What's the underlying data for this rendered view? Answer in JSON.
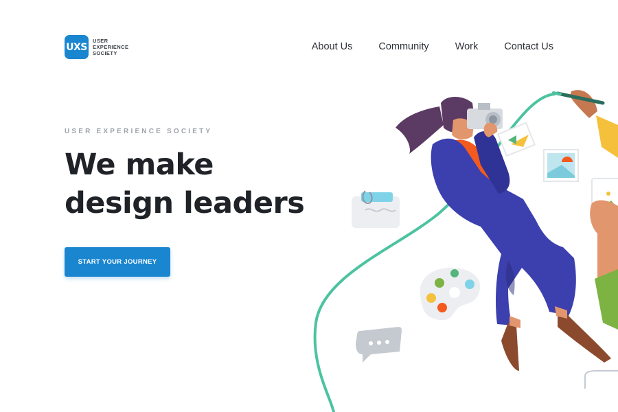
{
  "brand": {
    "logo_mark": "UXS",
    "name_lines": [
      "USER",
      "EXPERIENCE",
      "SOCIETY"
    ],
    "color": "#1a86d0"
  },
  "nav": {
    "items": [
      {
        "label": "About Us"
      },
      {
        "label": "Community"
      },
      {
        "label": "Work"
      },
      {
        "label": "Contact Us"
      }
    ]
  },
  "hero": {
    "eyebrow": "USER EXPERIENCE SOCIETY",
    "headline_line1": "We make",
    "headline_line2": "design leaders",
    "cta_label": "START YOUR JOURNEY"
  },
  "colors": {
    "accent": "#1a86d0",
    "text_dark": "#1f2227",
    "muted": "#9ea3aa",
    "curve": "#4cc3a0",
    "coat": "#3c3fae",
    "scarf": "#f35a1f"
  }
}
